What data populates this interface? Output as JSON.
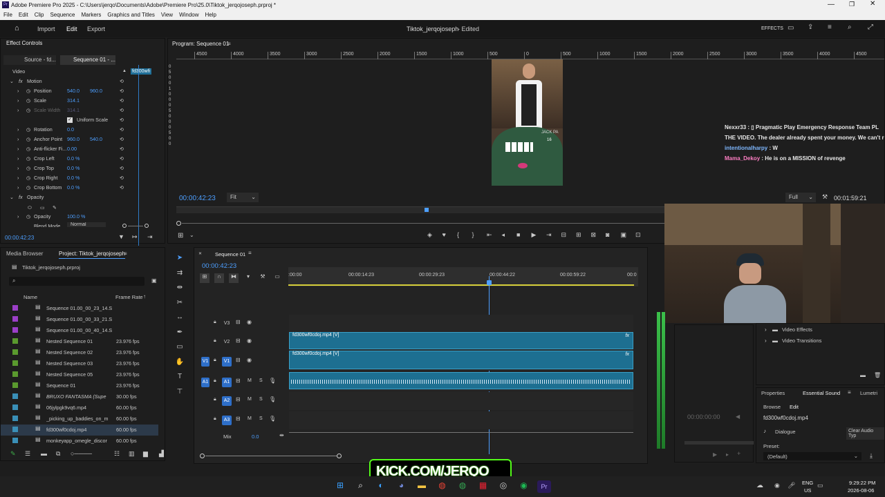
{
  "title_bar": {
    "text": "Adobe Premiere Pro 2025 - C:\\Users\\jerqo\\Documents\\Adobe\\Premiere Pro\\25.0\\Tiktok_jerqojoseph.prproj *",
    "app_icon": "premiere-icon"
  },
  "menu": [
    "File",
    "Edit",
    "Clip",
    "Sequence",
    "Markers",
    "Graphics and Titles",
    "View",
    "Window",
    "Help"
  ],
  "header": {
    "tabs": [
      "Import",
      "Edit",
      "Export"
    ],
    "active_tab": "Edit",
    "project_title": "Tiktok_jerqojoseph",
    "status": "- Edited",
    "effects_label": "EFFECTS"
  },
  "effect_controls": {
    "panel_title": "Effect Controls",
    "source_tab": "Source - fd...",
    "sequence_tab": "Sequence 01 - ...",
    "clip_chip": "fd300wfi",
    "section_video": "Video",
    "motion": "Motion",
    "rows": [
      {
        "label": "Position",
        "v1": "540.0",
        "v2": "960.0"
      },
      {
        "label": "Scale",
        "v1": "314.1",
        "v2": ""
      },
      {
        "label": "Scale Width",
        "v1": "314.1",
        "v2": ""
      },
      {
        "label": "Uniform Scale",
        "v1": "",
        "v2": ""
      },
      {
        "label": "Rotation",
        "v1": "0.0",
        "v2": ""
      },
      {
        "label": "Anchor Point",
        "v1": "960.0",
        "v2": "540.0"
      },
      {
        "label": "Anti-flicker Fi...",
        "v1": "0.00",
        "v2": ""
      },
      {
        "label": "Crop Left",
        "v1": "0.0 %",
        "v2": ""
      },
      {
        "label": "Crop Top",
        "v1": "0.0 %",
        "v2": ""
      },
      {
        "label": "Crop Right",
        "v1": "0.0 %",
        "v2": ""
      },
      {
        "label": "Crop Bottom",
        "v1": "0.0 %",
        "v2": ""
      }
    ],
    "opacity_section": "Opacity",
    "opacity_label": "Opacity",
    "opacity_value": "100.0 %",
    "blend_label": "Blend Mode",
    "blend_value": "Normal",
    "timecode": "00:00:42:23"
  },
  "program": {
    "title": "Program: Sequence 01",
    "ruler": [
      "4500",
      "4000",
      "3500",
      "3000",
      "2500",
      "2000",
      "1500",
      "1000",
      "500",
      "0",
      "500",
      "1000",
      "1500",
      "2000",
      "2500",
      "3000",
      "3500",
      "4000",
      "4500"
    ],
    "vruler": [
      "0",
      "5",
      "0",
      "0",
      "1",
      "0",
      "0",
      "0",
      "5",
      "0",
      "0",
      "0",
      "5",
      "0",
      "0"
    ],
    "timecode": "00:00:42:23",
    "fit": "Fit",
    "quality": "Full",
    "duration": "00:01:59:21",
    "table_text": "JACK PA",
    "table_num": "16"
  },
  "chat": [
    {
      "user": "Nexxr33",
      "color": "#e8e8e8",
      "msg": " : ▯ Pragmatic Play Emergency Response Team PL"
    },
    {
      "user": "",
      "color": "#e8e8e8",
      "msg": "THE VIDEO. The dealer already spent your money. We can't r"
    },
    {
      "user": "intentionalharpy",
      "color": "#7fb8ff",
      "msg": " : W"
    },
    {
      "user": "Mama_Dekoy",
      "color": "#ff7fc4",
      "msg": " : He is on a MISSION of revenge"
    }
  ],
  "project": {
    "tabs": [
      "Media Browser",
      "Project: Tiktok_jerqojoseph"
    ],
    "file": "Tiktok_jerqojoseph.prproj",
    "search_placeholder": "",
    "col_name": "Name",
    "col_rate": "Frame Rate",
    "items": [
      {
        "name": "Sequence 01.00_00_23_14.S",
        "rate": "",
        "color": "#9b3fc7"
      },
      {
        "name": "Sequence 01.00_00_33_21.S",
        "rate": "",
        "color": "#9b3fc7"
      },
      {
        "name": "Sequence 01.00_00_40_14.S",
        "rate": "",
        "color": "#9b3fc7"
      },
      {
        "name": "Nested Sequence 01",
        "rate": "23.976 fps",
        "color": "#5a9a2e"
      },
      {
        "name": "Nested Sequence 02",
        "rate": "23.976 fps",
        "color": "#5a9a2e"
      },
      {
        "name": "Nested Sequence 03",
        "rate": "23.976 fps",
        "color": "#5a9a2e"
      },
      {
        "name": "Nested Sequence 05",
        "rate": "23.976 fps",
        "color": "#5a9a2e"
      },
      {
        "name": "Sequence 01",
        "rate": "23.976 fps",
        "color": "#5a9a2e"
      },
      {
        "name": "BRUXO FANTASMA (Supe",
        "rate": "30.00 fps",
        "color": "#3a8fb7"
      },
      {
        "name": "06jylpgk9vq6.mp4",
        "rate": "60.00 fps",
        "color": "#3a8fb7"
      },
      {
        "name": "_picking_up_baddies_on_m",
        "rate": "60.00 fps",
        "color": "#3a8fb7"
      },
      {
        "name": "fd300wf0cdoj.mp4",
        "rate": "60.00 fps",
        "color": "#3a8fb7"
      },
      {
        "name": "monkeyapp_omegle_discor",
        "rate": "60.00 fps",
        "color": "#3a8fb7"
      }
    ]
  },
  "timeline": {
    "title": "Sequence 01",
    "timecode": "00:00:42:23",
    "ruler": [
      ":00:00",
      "00:00:14:23",
      "00:00:29:23",
      "00:00:44:22",
      "00:00:59:22",
      "00:0"
    ],
    "tracks": [
      "V3",
      "V2",
      "V1",
      "A1",
      "A2",
      "A3"
    ],
    "src_v": "V1",
    "src_a": "A1",
    "mix_label": "Mix",
    "mix_value": "0.0",
    "clip_v2": "fd300wf0cdoj.mp4 [V]",
    "clip_v1": "fd300wf0cdoj.mp4 [V]",
    "fx": "fx",
    "ms": [
      "M",
      "S"
    ]
  },
  "effects_panel": {
    "items": [
      "Video Effects",
      "Video Transitions"
    ]
  },
  "essential_sound": {
    "tabs": [
      "Properties",
      "Essential Sound",
      "Lumetri"
    ],
    "subtabs": [
      "Browse",
      "Edit"
    ],
    "clip": "fd300wf0cdoj.mp4",
    "dialogue": "Dialogue",
    "clear": "Clear Audio Typ",
    "preset_label": "Preset:",
    "preset_value": "(Default)"
  },
  "source_mini": {
    "timecode": "00:00:00:00"
  },
  "overlay": {
    "kick": "KICK.COM/JERQO"
  },
  "taskbar": {
    "lang1": "ENG",
    "lang2": "US",
    "time": "9:29:22 PM",
    "date": "2026-08-06"
  }
}
